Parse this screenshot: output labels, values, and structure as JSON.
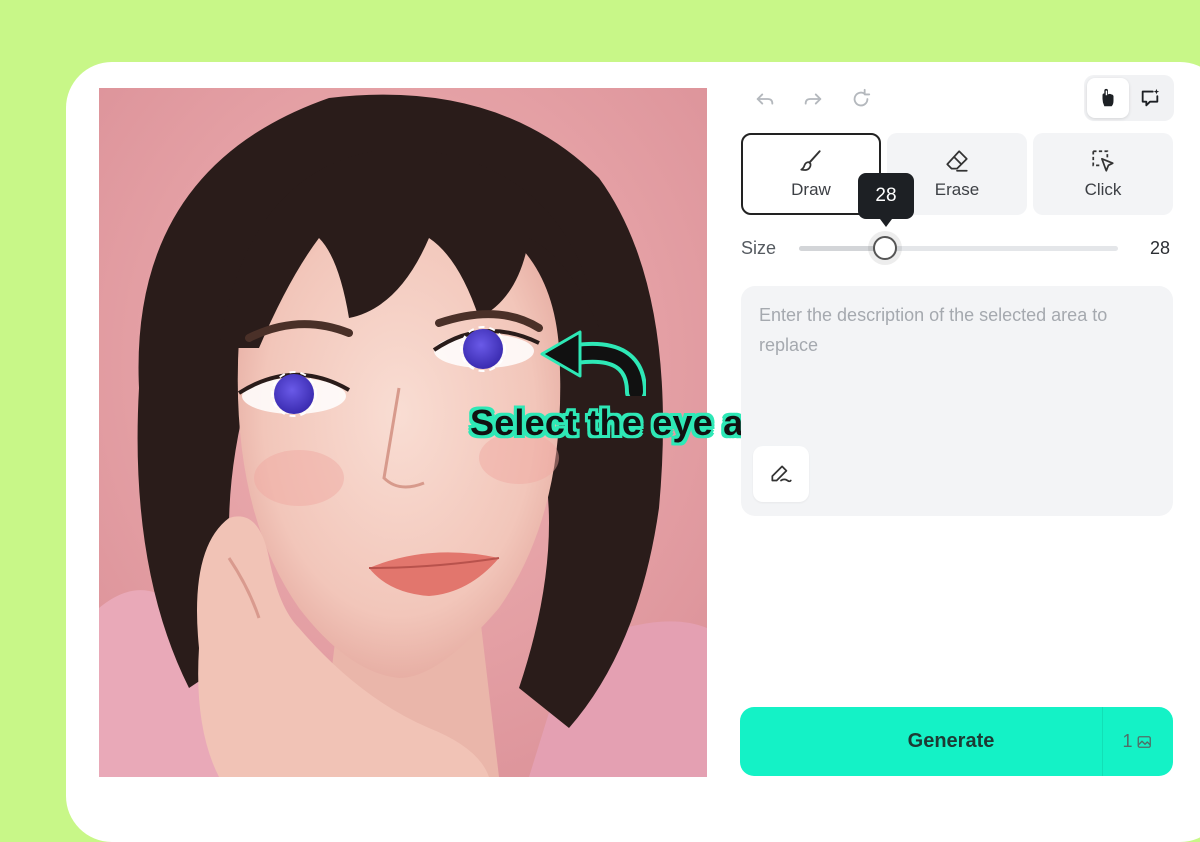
{
  "toolbar": {
    "undo_icon": "undo-icon",
    "redo_icon": "redo-icon",
    "reset_icon": "reset-icon",
    "mode_toggle": [
      {
        "icon": "hand-cursor-icon",
        "active": true
      },
      {
        "icon": "chat-sparkle-icon",
        "active": false
      }
    ]
  },
  "tools": [
    {
      "label": "Draw",
      "icon": "brush-icon",
      "active": true
    },
    {
      "label": "Erase",
      "icon": "eraser-icon",
      "active": false
    },
    {
      "label": "Click",
      "icon": "click-select-icon",
      "active": false
    }
  ],
  "brush": {
    "size_label": "Size",
    "size_value": "28",
    "tooltip_value": "28",
    "slider_fraction": 0.27
  },
  "prompt": {
    "placeholder": "Enter the description of the selected area to replace",
    "value": "",
    "tool_icon": "pen-edit-icon"
  },
  "generate": {
    "label": "Generate",
    "cost": "1",
    "cost_icon": "image-credit-icon"
  },
  "annotation": {
    "text": "Select the eye area",
    "arrow_icon": "curved-arrow-icon"
  },
  "colors": {
    "background": "#c8f788",
    "accent": "#14f2c6",
    "annotation_outline": "#2ee8b6",
    "eye_mask": "#4a3bc8"
  }
}
